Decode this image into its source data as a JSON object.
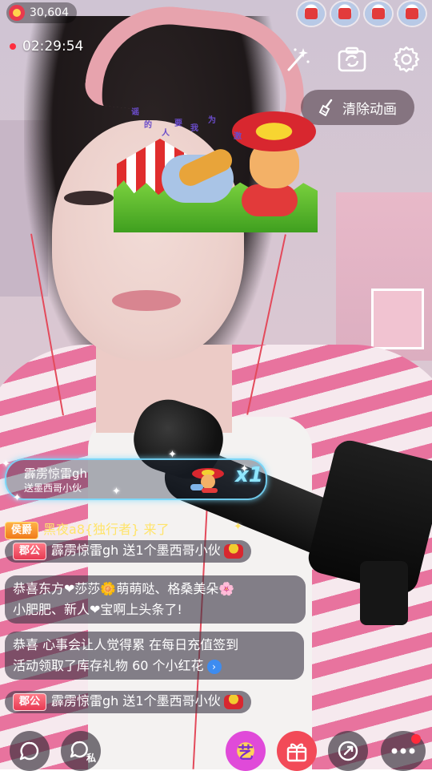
{
  "top_bar": {
    "viewer_count": "30,604",
    "live_timer": "02:29:54",
    "audience_avatars": [
      "avatar-1",
      "avatar-2",
      "avatar-3",
      "avatar-4"
    ]
  },
  "controls": {
    "magic_wand_icon": "magic-wand-icon",
    "camera_switch_icon": "camera-switch-icon",
    "settings_icon": "gear-icon",
    "clear_animation_label": "清除动画"
  },
  "gift_animation": {
    "floating_chars": [
      "谣",
      "的",
      "人",
      "要",
      "我",
      "为",
      "激"
    ]
  },
  "entry_banner": {
    "user_name": "霹雳惊雷gh",
    "gift_text": "送墨西哥小伙",
    "multiplier": "x1"
  },
  "chat": [
    {
      "badge": "侯爵",
      "badge_type": "hou",
      "text": "黑夜a8{独行者} 来了",
      "color": "#ffe46b"
    },
    {
      "badge": "郡公",
      "badge_type": "jun",
      "text": "霹雳惊雷gh 送1个墨西哥小伙",
      "color": "#ffffff",
      "has_gift_icon": true
    },
    {
      "badge": "",
      "text_line1": "恭喜东方❤莎莎🌼萌萌哒、格桑美朵🌸",
      "text_line2": "小肥肥、新人❤宝啊上头条了!"
    },
    {
      "badge": "",
      "text_line1": "恭喜 心事会让人觉得累 在每日充值签到",
      "text_line2": "活动领取了库存礼物 60 个小红花"
    },
    {
      "badge": "郡公",
      "badge_type": "jun",
      "text": "霹雳惊雷gh 送1个墨西哥小伙",
      "has_gift_icon": true
    }
  ],
  "bottom_bar": {
    "chat_icon": "chat-bubble-icon",
    "private_label": "私",
    "yi_label": "艺",
    "gift_icon": "gift-icon",
    "share_icon": "share-icon",
    "more_icon": "more-icon"
  }
}
